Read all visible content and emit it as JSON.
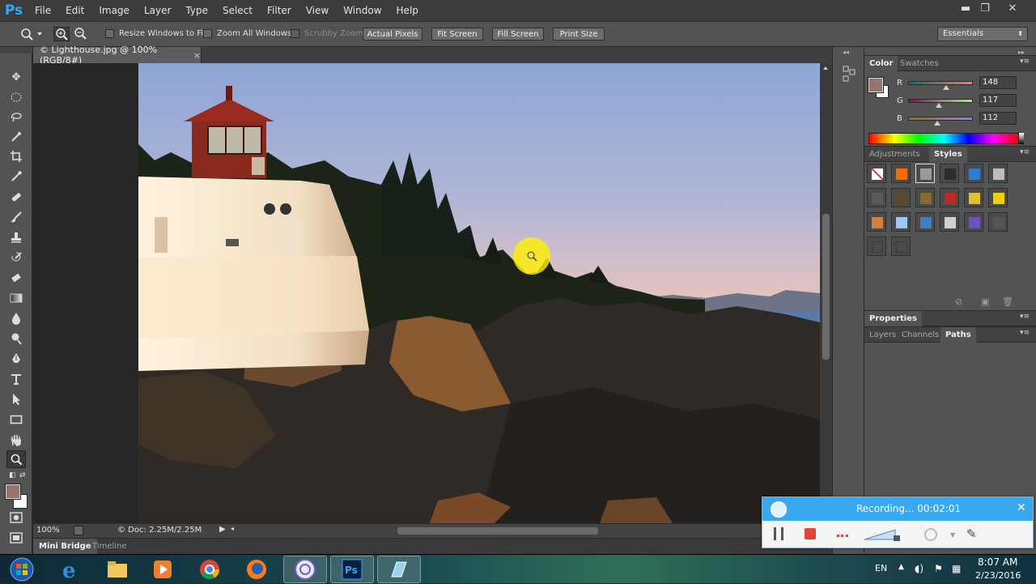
{
  "app": {
    "logo": "Ps"
  },
  "menu": [
    "File",
    "Edit",
    "Image",
    "Layer",
    "Type",
    "Select",
    "Filter",
    "View",
    "Window",
    "Help"
  ],
  "window_controls": {
    "minimize": "▬",
    "restore": "❐",
    "close": "✕"
  },
  "options_bar": {
    "resize_windows": "Resize Windows to Fit",
    "zoom_all": "Zoom All Windows",
    "scrubby": "Scrubby Zoom",
    "actual_pixels": "Actual Pixels",
    "fit_screen": "Fit Screen",
    "fill_screen": "Fill Screen",
    "print_size": "Print Size",
    "workspace": "Essentials"
  },
  "document": {
    "tab_title": "© Lighthouse.jpg @ 100% (RGB/8#)",
    "tab_close": "×"
  },
  "status": {
    "zoom": "100%",
    "doc_size": "© Doc: 2.25M/2.25M"
  },
  "bottom_tabs": {
    "mini_bridge": "Mini Bridge",
    "timeline": "Timeline"
  },
  "color_panel": {
    "tabs": [
      "Color",
      "Swatches"
    ],
    "foreground": "#947570",
    "channels": [
      {
        "label": "R",
        "value": "148"
      },
      {
        "label": "G",
        "value": "117"
      },
      {
        "label": "B",
        "value": "112"
      }
    ]
  },
  "styles_panel": {
    "tabs": [
      "Adjustments",
      "Styles"
    ],
    "swatches": [
      "#d33030",
      "#ff6a00",
      "#9a9a9a",
      "#2c2c2c",
      "#2a7fd4",
      "#bcbcbc",
      "#5a5a5a",
      "#5a4a28",
      "#8a6a30",
      "#c02828",
      "#e0c030",
      "#f0d000",
      "#d08040",
      "#9ac8f0",
      "#4080c0",
      "#d0d0d0",
      "#7050c0",
      "#555555",
      "#4a4a4a",
      "#4a4a4a"
    ]
  },
  "properties_panel": {
    "title": "Properties"
  },
  "layers_panel": {
    "tabs": [
      "Layers",
      "Channels",
      "Paths"
    ]
  },
  "recorder": {
    "status": "Recording... 00:02:01",
    "close": "✕"
  },
  "taskbar": {
    "lang": "EN",
    "time": "8:07 AM",
    "date": "2/23/2016"
  }
}
